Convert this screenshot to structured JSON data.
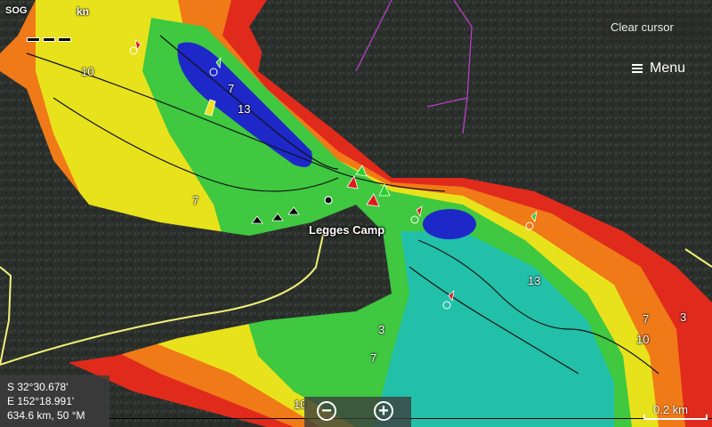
{
  "hud": {
    "sog_label": "SOG",
    "sog_unit": "kn"
  },
  "controls": {
    "clear_cursor": "Clear cursor",
    "menu": "Menu",
    "zoom_out": "−",
    "zoom_in": "+"
  },
  "place_name": "Legges Camp",
  "depth_labels": [
    "10",
    "7",
    "13",
    "7",
    "13",
    "7",
    "3",
    "10",
    "3",
    "7",
    "10"
  ],
  "position": {
    "lat": "S  32°30.678'",
    "lon": "E 152°18.991'",
    "range_bearing": "634.6 km, 50 °M"
  },
  "scale": {
    "label": "0.2 km"
  },
  "colors": {
    "land": "#2b2f2c",
    "shallow": "#e02a1c",
    "orange": "#f07a18",
    "yellow": "#e8e21c",
    "green": "#3fc840",
    "teal": "#22c0a8",
    "deep": "#1e28c8",
    "road": "#f2f078",
    "track": "#c040d0"
  },
  "markers": [
    "red-channel-marker",
    "green-channel-marker",
    "yellow-special-marker",
    "rock-hazard"
  ]
}
